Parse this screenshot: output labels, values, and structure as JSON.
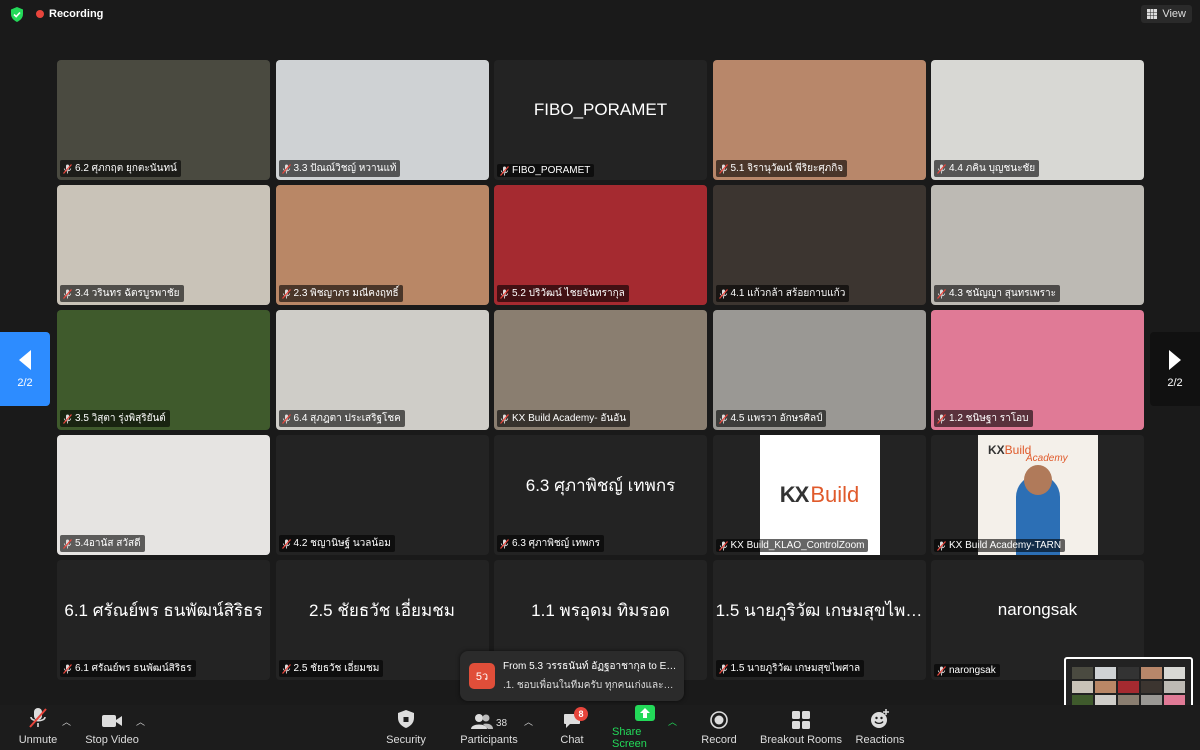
{
  "topbar": {
    "recording_label": "Recording",
    "view_label": "View"
  },
  "pagination": {
    "left_label": "2/2",
    "right_label": "2/2"
  },
  "tiles": [
    {
      "id": "t0",
      "tag": "6.2 ศุภกฤต ยุกตะนันทน์",
      "big": "",
      "bg": "#4a4a40"
    },
    {
      "id": "t1",
      "tag": "3.3 ปัณณ์วิชญ์ หวานแท้",
      "big": "",
      "bg": "#cfd2d4"
    },
    {
      "id": "t2",
      "tag": "FIBO_PORAMET",
      "big": "FIBO_PORAMET",
      "bg": "#232323"
    },
    {
      "id": "t3",
      "tag": "5.1 จิรานุวัฒน์ พีริยะศุภกิจ",
      "big": "",
      "bg": "#b8876a"
    },
    {
      "id": "t4",
      "tag": "4.4 ภคิน บุญชนะชัย",
      "big": "",
      "bg": "#d8d8d4"
    },
    {
      "id": "t5",
      "tag": "3.4 วรินทร ฉัตรบูรพาชัย",
      "big": "",
      "bg": "#c9c3b8"
    },
    {
      "id": "t6",
      "tag": "2.3 พิชญาภร มณีคงฤทธิ์",
      "big": "",
      "bg": "#b98766"
    },
    {
      "id": "t7",
      "tag": "5.2 ปริวัฒน์ ไชยจันทรากุล",
      "big": "",
      "bg": "#a52a30"
    },
    {
      "id": "t8",
      "tag": "4.1 แก้วกล้า สร้อยกาบแก้ว",
      "big": "",
      "bg": "#3c3530"
    },
    {
      "id": "t9",
      "tag": "4.3 ชนัญญา สุนทรเพราะ",
      "big": "",
      "bg": "#bdbab4"
    },
    {
      "id": "t10",
      "tag": "3.5 วิสุตา รุ่งพิสุริยันต์",
      "big": "",
      "bg": "#3f5a2c"
    },
    {
      "id": "t11",
      "tag": "6.4 สุภฎตา ประเสริฐโชค",
      "big": "",
      "bg": "#cfcdc8"
    },
    {
      "id": "t12",
      "tag": "KX Build Academy- อันอัน",
      "big": "",
      "bg": "#8a7e70"
    },
    {
      "id": "t13",
      "tag": "4.5 แพรวา อักษรศิลป์",
      "big": "",
      "bg": "#9a9894"
    },
    {
      "id": "t14",
      "tag": "1.2 ชนิษฐา ราโอบ",
      "big": "",
      "bg": "#e07a96"
    },
    {
      "id": "t15",
      "tag": "5.4อานัส สวัสดี",
      "big": "",
      "bg": "#e6e4e2"
    },
    {
      "id": "t16",
      "tag": "4.2 ชญานิษฐ์ นวลน้อม",
      "big": "",
      "bg": "#232323"
    },
    {
      "id": "t17",
      "tag": "6.3 ศุภาพิชญ์ เทพกร",
      "big": "6.3 ศุภาพิชญ์ เทพกร",
      "bg": "#232323"
    },
    {
      "id": "t18",
      "tag": "KX Build_KLAO_ControlZoom",
      "big": "",
      "bg": "#232323"
    },
    {
      "id": "t19",
      "tag": "KX Build Academy-TARN",
      "big": "",
      "bg": "#232323"
    },
    {
      "id": "t20",
      "tag": "6.1 ศรัณย์พร ธนพัฒน์สิริธร",
      "big": "6.1 ศรัณย์พร ธนพัฒน์สิริธร",
      "bg": "#232323"
    },
    {
      "id": "t21",
      "tag": "2.5 ชัยธวัช เอี่ยมชม",
      "big": "2.5 ชัยธวัช เอี่ยมชม",
      "bg": "#232323"
    },
    {
      "id": "t22",
      "tag": "",
      "big": "1.1 พรอุดม ทิมรอด",
      "bg": "#232323"
    },
    {
      "id": "t23",
      "tag": "1.5 นายภูริวัฒ เกษมสุขไพศาล",
      "big": "1.5 นายภูริวัฒ เกษมสุขไพ…",
      "bg": "#232323"
    },
    {
      "id": "t24",
      "tag": "narongsak",
      "big": "narongsak",
      "bg": "#232323"
    }
  ],
  "kx_logo": {
    "text_kx": "KX",
    "text_build": "Build",
    "academy": "Academy"
  },
  "chat_popup": {
    "avatar": "5ว",
    "line1": "From 5.3 วรรธนันท์ อัฏฐอาชากุล to Ev...",
    "line2": ".1. ชอบเพื่อนในทีมครับ ทุกคนเก่งและพู..."
  },
  "toolbar": {
    "unmute": "Unmute",
    "stop_video": "Stop Video",
    "security": "Security",
    "participants": "Participants",
    "participants_count": "38",
    "chat": "Chat",
    "chat_badge": "8",
    "share_screen": "Share Screen",
    "record": "Record",
    "breakout": "Breakout Rooms",
    "reactions": "Reactions"
  },
  "colors": {
    "accent": "#2d8cff",
    "share_green": "#23d959",
    "alert_red": "#e8453c"
  }
}
